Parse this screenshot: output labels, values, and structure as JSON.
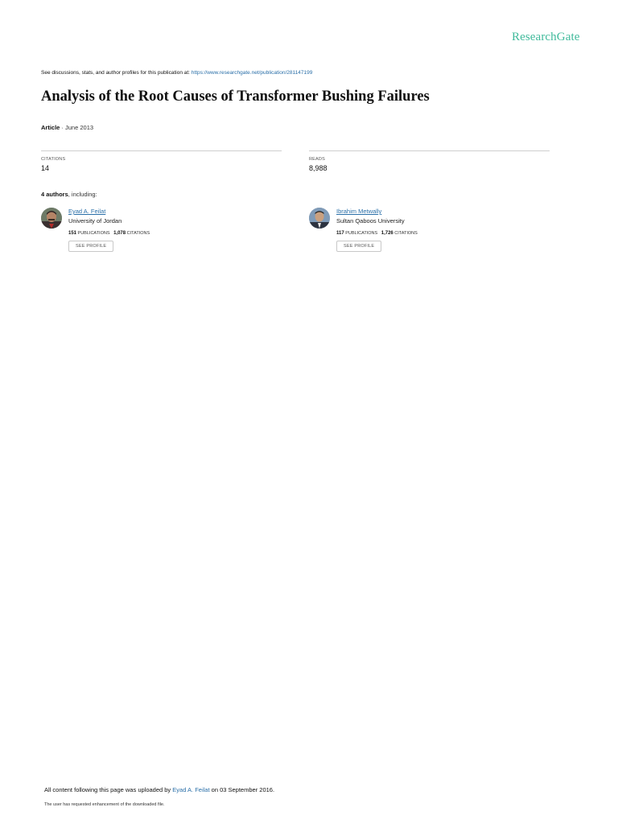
{
  "brand": {
    "logo_text": "ResearchGate"
  },
  "header": {
    "discussion_prefix": "See discussions, stats, and author profiles for this publication at: ",
    "publication_url": "https://www.researchgate.net/publication/281147199"
  },
  "publication": {
    "title": "Analysis of the Root Causes of Transformer Bushing Failures",
    "type": "Article",
    "separator": " · ",
    "date": "June 2013"
  },
  "stats": {
    "citations_label": "CITATIONS",
    "citations_value": "14",
    "reads_label": "READS",
    "reads_value": "8,988"
  },
  "authors_summary": {
    "count_text": "4 authors",
    "suffix": ", including:"
  },
  "authors": [
    {
      "name": "Eyad A. Feilat",
      "institution": "University of Jordan",
      "publications": "151",
      "publications_label": "PUBLICATIONS",
      "separator": "   ",
      "citations": "1,078",
      "citations_label": "CITATIONS",
      "button_label": "SEE PROFILE"
    },
    {
      "name": "Ibrahim Metwally",
      "institution": "Sultan Qaboos University",
      "publications": "117",
      "publications_label": "PUBLICATIONS",
      "separator": "   ",
      "citations": "1,726",
      "citations_label": "CITATIONS",
      "button_label": "SEE PROFILE"
    }
  ],
  "footer": {
    "uploaded_prefix": "All content following this page was uploaded by ",
    "uploader": "Eyad A. Feilat",
    "uploaded_suffix": " on 03 September 2016.",
    "enhancement_note": "The user has requested enhancement of the downloaded file."
  },
  "colors": {
    "brand": "#40ba9b",
    "link": "#2a6fa8",
    "divider": "#cfcfcf"
  }
}
